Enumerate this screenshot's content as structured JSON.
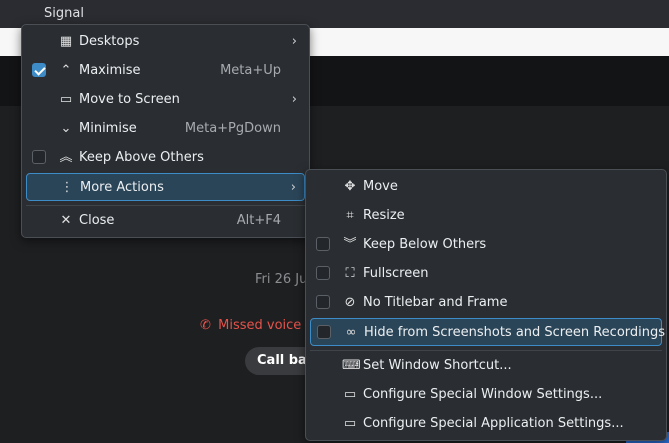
{
  "window": {
    "title": "Signal"
  },
  "chat": {
    "date": "Fri 26 Ju",
    "missed_call": "Missed voice",
    "call_back": "Call bac"
  },
  "main_menu": {
    "items": [
      {
        "label": "Desktops",
        "shortcut": "",
        "icon": "desktops-grid-icon",
        "glyph": "▦",
        "has_submenu": true,
        "checkbox": null
      },
      {
        "label": "Maximise",
        "shortcut": "Meta+Up",
        "icon": "maximise-chevron-up-icon",
        "glyph": "⌃",
        "has_submenu": false,
        "checkbox": true
      },
      {
        "label": "Move to Screen",
        "shortcut": "",
        "icon": "monitor-icon",
        "glyph": "🖵",
        "has_submenu": true,
        "checkbox": null
      },
      {
        "label": "Minimise",
        "shortcut": "Meta+PgDown",
        "icon": "minimise-chevron-down-icon",
        "glyph": "⌄",
        "has_submenu": false,
        "checkbox": null
      },
      {
        "label": "Keep Above Others",
        "shortcut": "",
        "icon": "keep-above-icon",
        "glyph": "⌃",
        "has_submenu": false,
        "checkbox": false
      },
      {
        "label": "More Actions",
        "shortcut": "",
        "icon": "more-actions-icon",
        "glyph": "⋮",
        "has_submenu": true,
        "checkbox": null,
        "highlighted": true
      },
      {
        "label": "Close",
        "shortcut": "Alt+F4",
        "icon": "close-icon",
        "glyph": "✕",
        "has_submenu": false,
        "checkbox": null
      }
    ]
  },
  "sub_menu": {
    "items": [
      {
        "label": "Move",
        "icon": "move-arrows-icon",
        "glyph": "✥",
        "checkbox": null
      },
      {
        "label": "Resize",
        "icon": "resize-icon",
        "glyph": "⛶",
        "checkbox": null
      },
      {
        "label": "Keep Below Others",
        "icon": "keep-below-icon",
        "glyph": "⌄",
        "checkbox": false
      },
      {
        "label": "Fullscreen",
        "icon": "fullscreen-icon",
        "glyph": "⛶",
        "checkbox": false
      },
      {
        "label": "No Titlebar and Frame",
        "icon": "no-titlebar-icon",
        "glyph": "⃠",
        "checkbox": false
      },
      {
        "label": "Hide from Screenshots and Screen Recordings",
        "icon": "hide-spy-icon",
        "glyph": "👓",
        "checkbox": false,
        "highlighted": true
      },
      {
        "label": "Set Window Shortcut...",
        "icon": "keyboard-icon",
        "glyph": "⌨",
        "checkbox": null
      },
      {
        "label": "Configure Special Window Settings...",
        "icon": "window-settings-icon",
        "glyph": "▭",
        "checkbox": null
      },
      {
        "label": "Configure Special Application Settings...",
        "icon": "app-settings-icon",
        "glyph": "▭",
        "checkbox": null
      }
    ]
  }
}
